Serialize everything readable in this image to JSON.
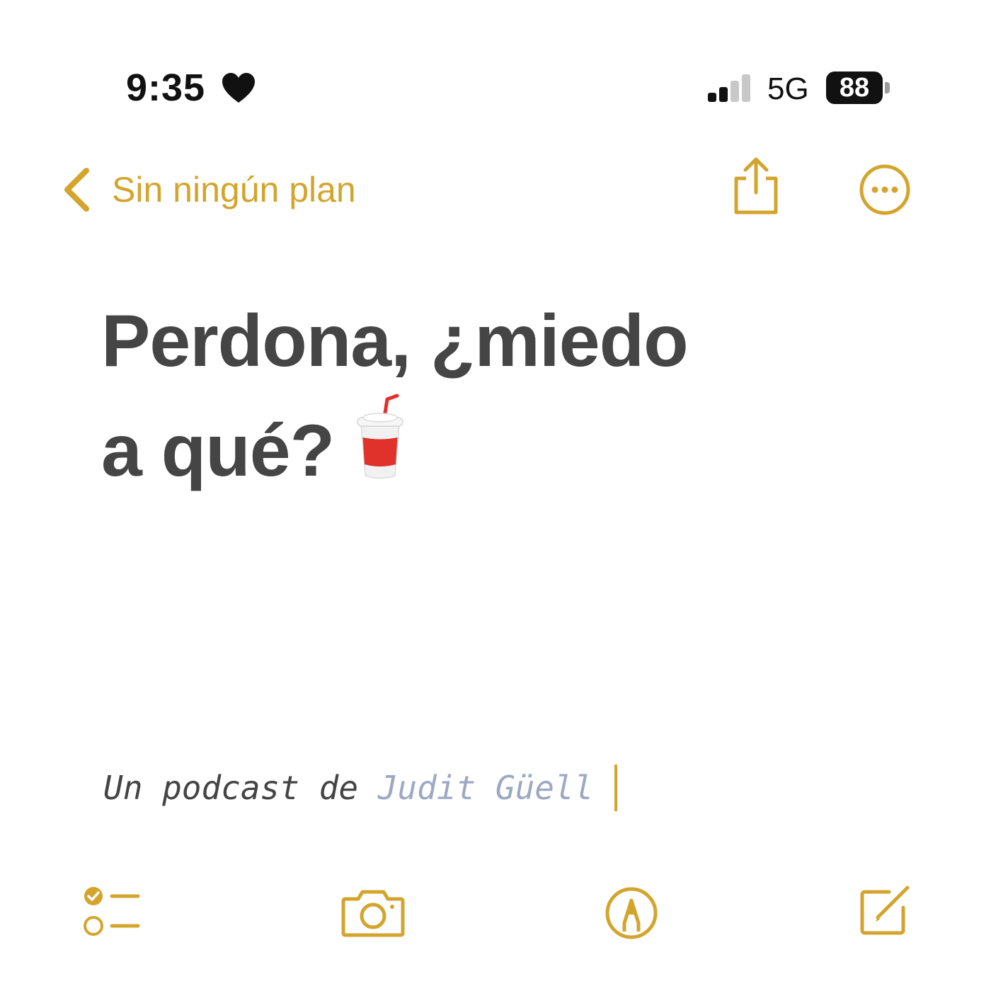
{
  "status_bar": {
    "time": "9:35",
    "network": "5G",
    "battery": "88"
  },
  "nav": {
    "back_label": "Sin ningún plan"
  },
  "note": {
    "title_line1": "Perdona, ¿miedo",
    "title_line2": "a qué?",
    "emoji": "cup-with-straw",
    "body_prefix": "Un podcast de ",
    "body_author": "Judit Güell"
  },
  "colors": {
    "accent": "#d3a52d",
    "title_text": "#454545",
    "author_text": "#9ca9c3",
    "emoji_red": "#e0312b"
  },
  "toolbar": {
    "icons": [
      "checklist-icon",
      "camera-icon",
      "markup-icon",
      "compose-icon"
    ]
  }
}
